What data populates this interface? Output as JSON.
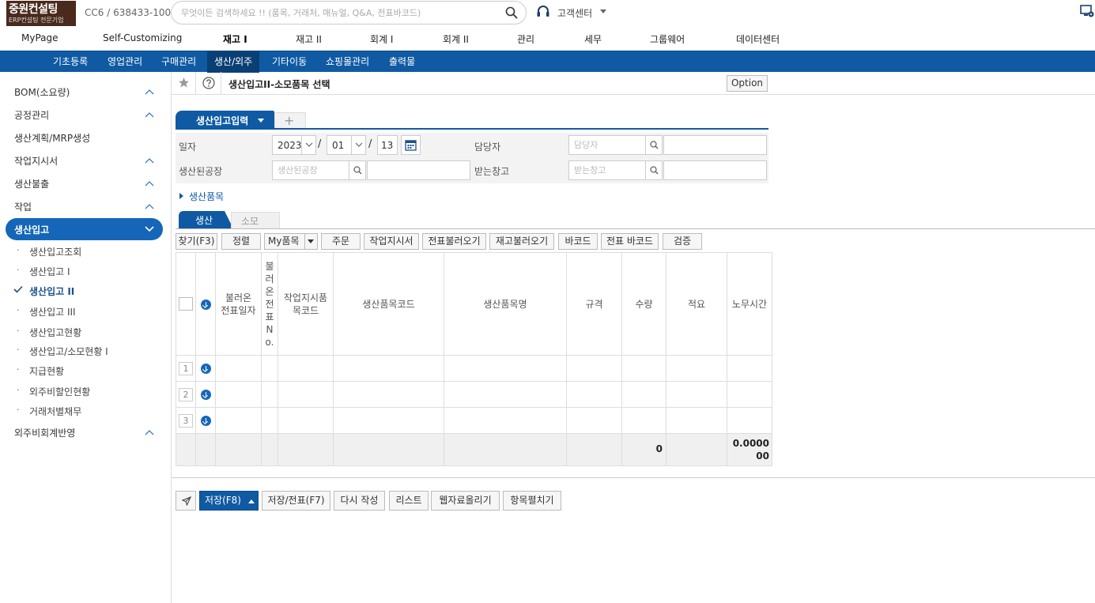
{
  "logo": {
    "line1": "중원컨설팅",
    "line2": "ERP컨설팅 전문기업"
  },
  "company_id": "CC6 / 638433-100",
  "search": {
    "placeholder": "무엇이든 검색하세요 !! (품목, 거래처, 매뉴얼, Q&A, 전표바코드)",
    "value": ""
  },
  "support": {
    "label": "고객센터"
  },
  "main_menu": [
    {
      "label": "MyPage"
    },
    {
      "label": "Self-Customizing"
    },
    {
      "label": "재고 I"
    },
    {
      "label": "재고 II"
    },
    {
      "label": "회계 I"
    },
    {
      "label": "회계 II"
    },
    {
      "label": "관리"
    },
    {
      "label": "세무"
    },
    {
      "label": "그룹웨어"
    },
    {
      "label": "데이터센터"
    }
  ],
  "sub_menu": [
    {
      "label": "기초등록"
    },
    {
      "label": "영업관리"
    },
    {
      "label": "구매관리"
    },
    {
      "label": "생산/외주"
    },
    {
      "label": "기타이동"
    },
    {
      "label": "쇼핑몰관리"
    },
    {
      "label": "출력물"
    }
  ],
  "sidebar": {
    "groups": [
      {
        "label": "BOM(소요량)"
      },
      {
        "label": "공정관리"
      },
      {
        "label": "생산계획/MRP생성"
      },
      {
        "label": "작업지시서"
      },
      {
        "label": "생산불출"
      },
      {
        "label": "작업"
      },
      {
        "label": "생산입고"
      },
      {
        "label": "외주비회계반영"
      }
    ],
    "bullet": "·",
    "sub_items": [
      {
        "label": "생산입고조회"
      },
      {
        "label": "생산입고 I"
      },
      {
        "label": "생산입고 II"
      },
      {
        "label": "생산입고 III"
      },
      {
        "label": "생산입고현황"
      },
      {
        "label": "생산입고/소모현황 I"
      },
      {
        "label": "지급현황"
      },
      {
        "label": "외주비할인현황"
      },
      {
        "label": "거래처별채무"
      }
    ]
  },
  "header": {
    "title": "생산입고II-소모품목 선택",
    "option_label": "Option"
  },
  "form_tab": {
    "label": "생산입고입력",
    "add_label": "+"
  },
  "form": {
    "date_label": "일자",
    "year": "2023",
    "month": "01",
    "day": "13",
    "sep": "/",
    "manager_label": "담당자",
    "manager_placeholder": "담당자",
    "factory_label": "생산된공장",
    "factory_placeholder": "생산된공장",
    "warehouse_label": "받는창고",
    "warehouse_placeholder": "받는창고",
    "expand_label": "생산품목"
  },
  "grid_tabs": [
    {
      "label": "생산"
    },
    {
      "label": "소모"
    }
  ],
  "grid_toolbar": [
    {
      "label": "찾기(F3)"
    },
    {
      "label": "정렬"
    },
    {
      "label": "My품목"
    },
    {
      "label": "주문"
    },
    {
      "label": "작업지시서"
    },
    {
      "label": "전표불러오기"
    },
    {
      "label": "재고불러오기"
    },
    {
      "label": "바코드"
    },
    {
      "label": "전표 바코드"
    },
    {
      "label": "검증"
    }
  ],
  "grid": {
    "columns": [
      {
        "label": "불러온 전표일자"
      },
      {
        "label": "불러온전표No."
      },
      {
        "label": "작업지시품 목코드"
      },
      {
        "label": "생산품목코드"
      },
      {
        "label": "생산품목명"
      },
      {
        "label": "규격"
      },
      {
        "label": "수량"
      },
      {
        "label": "적요"
      },
      {
        "label": "노무시간"
      }
    ],
    "rows": [
      {
        "num": "1"
      },
      {
        "num": "2"
      },
      {
        "num": "3"
      }
    ],
    "totals": {
      "qty": "0",
      "labor_hours": "0.000000"
    }
  },
  "bottom_buttons": [
    {
      "label": "저장(F8)"
    },
    {
      "label": "저장/전표(F7)"
    },
    {
      "label": "다시 작성"
    },
    {
      "label": "리스트"
    },
    {
      "label": "웹자료올리기"
    },
    {
      "label": "항목펼치기"
    }
  ],
  "colors": {
    "primary": "#0f5aa3",
    "sidebar_active": "#1566b8",
    "logo_bg": "#4a2a1c"
  },
  "icons": {
    "search": "search-icon",
    "support": "headset-icon",
    "monitor": "monitor-icon",
    "star": "star-icon",
    "help": "help-icon",
    "calendar": "calendar-icon",
    "send": "send-icon"
  }
}
